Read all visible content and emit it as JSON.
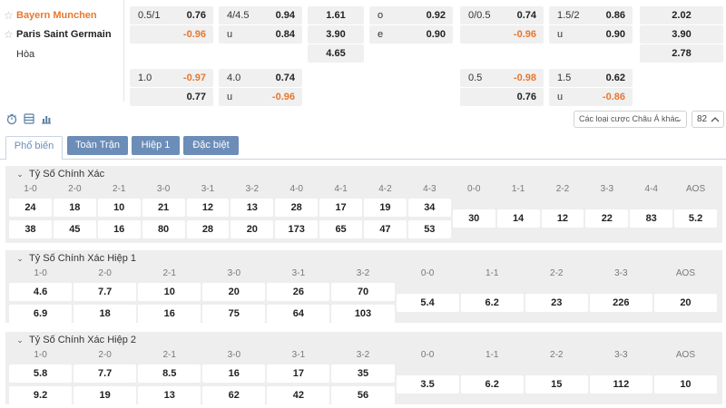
{
  "match": {
    "home": "Bayern Munchen",
    "away": "Paris Saint Germain",
    "draw": "Hòa"
  },
  "odds": {
    "ah_main": {
      "home_line": "0.5/1",
      "home_odds": "0.76",
      "away_odds": "-0.96"
    },
    "ou_main": {
      "line": "4/4.5",
      "over_label": "o",
      "under_label": "u",
      "over_odds": "0.94",
      "under_odds": "0.84"
    },
    "x12_ft": {
      "home": "1.61",
      "away": "3.90",
      "draw": "4.65"
    },
    "oe": {
      "odd_label": "o",
      "even_label": "e",
      "odd_odds": "0.92",
      "even_odds": "0.90"
    },
    "ah_h1": {
      "home_line": "0/0.5",
      "home_odds": "0.74",
      "away_odds": "-0.96"
    },
    "ou_h1": {
      "line": "1.5/2",
      "under_label": "u",
      "over_odds": "0.86",
      "under_odds": "0.90"
    },
    "x12_h1": {
      "home": "2.02",
      "away": "3.90",
      "draw": "2.78"
    },
    "ah_alt": {
      "home_line": "1.0",
      "home_odds": "-0.97",
      "away_odds": "0.77"
    },
    "ou_alt": {
      "line": "4.0",
      "under_label": "u",
      "over_odds": "0.74",
      "under_odds": "-0.96"
    },
    "ah_h1_alt": {
      "home_line": "0.5",
      "home_odds": "-0.98",
      "away_odds": "0.76"
    },
    "ou_h1_alt": {
      "line": "1.5",
      "under_label": "u",
      "over_odds": "0.62",
      "under_odds": "-0.86"
    }
  },
  "toolbar": {
    "icons": [
      "timer-icon",
      "list-icon",
      "bar-chart-icon"
    ],
    "market_select": "Các loại cược Châu Á khác",
    "market_count": "82"
  },
  "tabs": [
    "Phổ biến",
    "Toàn Trận",
    "Hiệp 1",
    "Đặc biệt"
  ],
  "sections": [
    {
      "title": "Tỷ Số Chính Xác",
      "pairs": [
        {
          "label": "1-0",
          "a": "24",
          "b": "38"
        },
        {
          "label": "2-0",
          "a": "18",
          "b": "45"
        },
        {
          "label": "2-1",
          "a": "10",
          "b": "16"
        },
        {
          "label": "3-0",
          "a": "21",
          "b": "80"
        },
        {
          "label": "3-1",
          "a": "12",
          "b": "28"
        },
        {
          "label": "3-2",
          "a": "13",
          "b": "20"
        },
        {
          "label": "4-0",
          "a": "28",
          "b": "173"
        },
        {
          "label": "4-1",
          "a": "17",
          "b": "65"
        },
        {
          "label": "4-2",
          "a": "19",
          "b": "47"
        },
        {
          "label": "4-3",
          "a": "34",
          "b": "53"
        }
      ],
      "singles": [
        {
          "label": "0-0",
          "v": "30"
        },
        {
          "label": "1-1",
          "v": "14"
        },
        {
          "label": "2-2",
          "v": "12"
        },
        {
          "label": "3-3",
          "v": "22"
        },
        {
          "label": "4-4",
          "v": "83"
        },
        {
          "label": "AOS",
          "v": "5.2"
        }
      ]
    },
    {
      "title": "Tỷ Số Chính Xác Hiệp 1",
      "pairs": [
        {
          "label": "1-0",
          "a": "4.6",
          "b": "6.9"
        },
        {
          "label": "2-0",
          "a": "7.7",
          "b": "18"
        },
        {
          "label": "2-1",
          "a": "10",
          "b": "16"
        },
        {
          "label": "3-0",
          "a": "20",
          "b": "75"
        },
        {
          "label": "3-1",
          "a": "26",
          "b": "64"
        },
        {
          "label": "3-2",
          "a": "70",
          "b": "103"
        }
      ],
      "singles": [
        {
          "label": "0-0",
          "v": "5.4"
        },
        {
          "label": "1-1",
          "v": "6.2"
        },
        {
          "label": "2-2",
          "v": "23"
        },
        {
          "label": "3-3",
          "v": "226"
        },
        {
          "label": "AOS",
          "v": "20"
        }
      ]
    },
    {
      "title": "Tỷ Số Chính Xác Hiệp 2",
      "pairs": [
        {
          "label": "1-0",
          "a": "5.8",
          "b": "9.2"
        },
        {
          "label": "2-0",
          "a": "7.7",
          "b": "19"
        },
        {
          "label": "2-1",
          "a": "8.5",
          "b": "13"
        },
        {
          "label": "3-0",
          "a": "16",
          "b": "62"
        },
        {
          "label": "3-1",
          "a": "17",
          "b": "42"
        },
        {
          "label": "3-2",
          "a": "35",
          "b": "56"
        }
      ],
      "singles": [
        {
          "label": "0-0",
          "v": "3.5"
        },
        {
          "label": "1-1",
          "v": "6.2"
        },
        {
          "label": "2-2",
          "v": "15"
        },
        {
          "label": "3-3",
          "v": "112"
        },
        {
          "label": "AOS",
          "v": "10"
        }
      ]
    }
  ]
}
